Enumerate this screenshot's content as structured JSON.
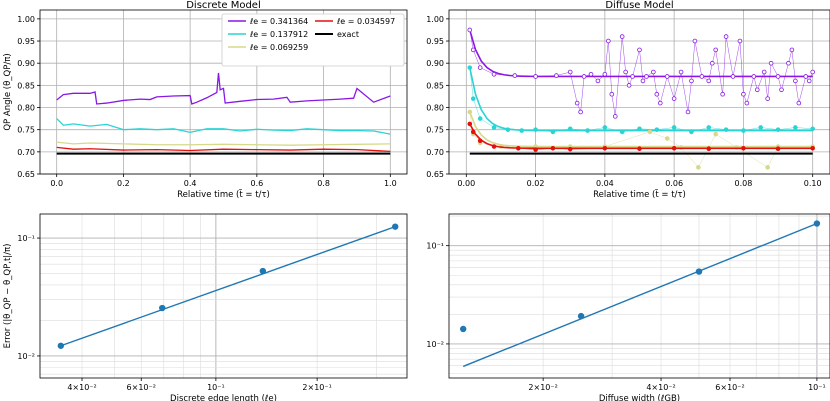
{
  "chart_data": [
    {
      "type": "line",
      "title": "Discrete Model",
      "xlabel": "Relative time (t̃ = t/τ)",
      "ylabel": "QP Angle (θ_QP/π)",
      "xlim": [
        -0.05,
        1.05
      ],
      "ylim": [
        0.65,
        1.02
      ],
      "xticks": [
        0.0,
        0.2,
        0.4,
        0.6,
        0.8,
        1.0
      ],
      "yticks": [
        0.65,
        0.7,
        0.75,
        0.8,
        0.85,
        0.9,
        0.95,
        1.0
      ],
      "grid": true,
      "legend_position": "top-right",
      "series": [
        {
          "name": "ℓe = 0.341364",
          "color": "#8a17e6",
          "x": [
            0.0,
            0.02,
            0.05,
            0.1,
            0.115,
            0.12,
            0.15,
            0.2,
            0.25,
            0.28,
            0.3,
            0.35,
            0.4,
            0.405,
            0.42,
            0.45,
            0.48,
            0.485,
            0.49,
            0.5,
            0.505,
            0.55,
            0.6,
            0.65,
            0.69,
            0.7,
            0.75,
            0.8,
            0.85,
            0.89,
            0.9,
            0.95,
            1.0
          ],
          "y": [
            0.817,
            0.829,
            0.832,
            0.832,
            0.835,
            0.808,
            0.81,
            0.816,
            0.819,
            0.818,
            0.824,
            0.826,
            0.827,
            0.808,
            0.812,
            0.822,
            0.834,
            0.878,
            0.84,
            0.843,
            0.81,
            0.814,
            0.818,
            0.819,
            0.823,
            0.812,
            0.815,
            0.817,
            0.819,
            0.821,
            0.843,
            0.812,
            0.826
          ]
        },
        {
          "name": "ℓe = 0.137912",
          "color": "#2bd4d4",
          "x": [
            0.0,
            0.02,
            0.05,
            0.1,
            0.15,
            0.2,
            0.25,
            0.3,
            0.35,
            0.4,
            0.45,
            0.5,
            0.55,
            0.6,
            0.65,
            0.7,
            0.75,
            0.8,
            0.85,
            0.9,
            0.95,
            1.0
          ],
          "y": [
            0.775,
            0.76,
            0.763,
            0.758,
            0.762,
            0.75,
            0.752,
            0.75,
            0.752,
            0.744,
            0.752,
            0.752,
            0.747,
            0.751,
            0.749,
            0.748,
            0.752,
            0.75,
            0.748,
            0.748,
            0.747,
            0.74
          ]
        },
        {
          "name": "ℓe = 0.069259",
          "color": "#d6d98a",
          "x": [
            0.0,
            0.05,
            0.1,
            0.2,
            0.3,
            0.4,
            0.5,
            0.6,
            0.7,
            0.8,
            0.9,
            1.0
          ],
          "y": [
            0.722,
            0.718,
            0.72,
            0.718,
            0.716,
            0.716,
            0.717,
            0.716,
            0.715,
            0.716,
            0.717,
            0.718
          ]
        },
        {
          "name": "ℓe = 0.034597",
          "color": "#e31010",
          "x": [
            0.0,
            0.05,
            0.1,
            0.2,
            0.3,
            0.4,
            0.5,
            0.6,
            0.7,
            0.8,
            0.9,
            1.0
          ],
          "y": [
            0.71,
            0.706,
            0.707,
            0.704,
            0.705,
            0.703,
            0.706,
            0.705,
            0.704,
            0.706,
            0.705,
            0.701
          ]
        },
        {
          "name": "exact",
          "color": "#000000",
          "x": [
            0.0,
            1.0
          ],
          "y": [
            0.696,
            0.696
          ]
        }
      ]
    },
    {
      "type": "line",
      "title": "Diffuse Model",
      "xlabel": "Relative time (t̃ = t/τ)",
      "ylabel": "",
      "xlim": [
        -0.005,
        0.105
      ],
      "ylim": [
        0.65,
        1.02
      ],
      "xticks": [
        0.0,
        0.02,
        0.04,
        0.06,
        0.08,
        0.1
      ],
      "xtick_labels": [
        "0.00",
        "0.02",
        "0.04",
        "0.06",
        "0.08",
        "0.10"
      ],
      "yticks": [
        0.65,
        0.7,
        0.75,
        0.8,
        0.85,
        0.9,
        0.95,
        1.0
      ],
      "grid": true,
      "series": [
        {
          "color": "#8a17e6",
          "fit_value": 0.87,
          "start": 0.975,
          "points": [
            [
              0.001,
              0.975
            ],
            [
              0.002,
              0.93
            ],
            [
              0.004,
              0.89
            ],
            [
              0.008,
              0.875
            ],
            [
              0.014,
              0.872
            ],
            [
              0.02,
              0.87
            ],
            [
              0.026,
              0.872
            ],
            [
              0.03,
              0.88
            ],
            [
              0.032,
              0.81
            ],
            [
              0.033,
              0.79
            ],
            [
              0.034,
              0.87
            ],
            [
              0.036,
              0.875
            ],
            [
              0.038,
              0.86
            ],
            [
              0.04,
              0.875
            ],
            [
              0.041,
              0.95
            ],
            [
              0.042,
              0.83
            ],
            [
              0.043,
              0.78
            ],
            [
              0.045,
              0.96
            ],
            [
              0.046,
              0.88
            ],
            [
              0.047,
              0.85
            ],
            [
              0.048,
              0.87
            ],
            [
              0.05,
              0.93
            ],
            [
              0.051,
              0.86
            ],
            [
              0.052,
              0.87
            ],
            [
              0.054,
              0.88
            ],
            [
              0.055,
              0.83
            ],
            [
              0.056,
              0.81
            ],
            [
              0.058,
              0.87
            ],
            [
              0.06,
              0.82
            ],
            [
              0.062,
              0.88
            ],
            [
              0.064,
              0.79
            ],
            [
              0.065,
              0.86
            ],
            [
              0.066,
              0.95
            ],
            [
              0.068,
              0.87
            ],
            [
              0.07,
              0.86
            ],
            [
              0.071,
              0.9
            ],
            [
              0.072,
              0.93
            ],
            [
              0.074,
              0.83
            ],
            [
              0.075,
              0.96
            ],
            [
              0.077,
              0.87
            ],
            [
              0.079,
              0.95
            ],
            [
              0.08,
              0.83
            ],
            [
              0.081,
              0.81
            ],
            [
              0.083,
              0.87
            ],
            [
              0.084,
              0.84
            ],
            [
              0.086,
              0.88
            ],
            [
              0.087,
              0.82
            ],
            [
              0.088,
              0.9
            ],
            [
              0.09,
              0.87
            ],
            [
              0.091,
              0.84
            ],
            [
              0.093,
              0.9
            ],
            [
              0.094,
              0.93
            ],
            [
              0.095,
              0.86
            ],
            [
              0.096,
              0.81
            ],
            [
              0.098,
              0.87
            ],
            [
              0.099,
              0.86
            ],
            [
              0.1,
              0.88
            ]
          ]
        },
        {
          "color": "#2bd4d4",
          "fit_value": 0.748,
          "start": 0.89,
          "points": [
            [
              0.001,
              0.89
            ],
            [
              0.002,
              0.82
            ],
            [
              0.004,
              0.775
            ],
            [
              0.008,
              0.755
            ],
            [
              0.012,
              0.75
            ],
            [
              0.016,
              0.748
            ],
            [
              0.02,
              0.75
            ],
            [
              0.025,
              0.745
            ],
            [
              0.03,
              0.752
            ],
            [
              0.035,
              0.748
            ],
            [
              0.04,
              0.755
            ],
            [
              0.045,
              0.745
            ],
            [
              0.05,
              0.752
            ],
            [
              0.055,
              0.75
            ],
            [
              0.06,
              0.755
            ],
            [
              0.065,
              0.745
            ],
            [
              0.07,
              0.755
            ],
            [
              0.075,
              0.75
            ],
            [
              0.08,
              0.748
            ],
            [
              0.085,
              0.755
            ],
            [
              0.09,
              0.75
            ],
            [
              0.095,
              0.755
            ],
            [
              0.1,
              0.752
            ]
          ]
        },
        {
          "color": "#d6d98a",
          "fit_value": 0.712,
          "start": 0.79,
          "points": [
            [
              0.001,
              0.79
            ],
            [
              0.002,
              0.74
            ],
            [
              0.004,
              0.72
            ],
            [
              0.01,
              0.712
            ],
            [
              0.02,
              0.712
            ],
            [
              0.03,
              0.712
            ],
            [
              0.04,
              0.712
            ],
            [
              0.053,
              0.745
            ],
            [
              0.058,
              0.73
            ],
            [
              0.062,
              0.71
            ],
            [
              0.067,
              0.665
            ],
            [
              0.072,
              0.74
            ],
            [
              0.078,
              0.71
            ],
            [
              0.087,
              0.665
            ],
            [
              0.09,
              0.712
            ],
            [
              0.1,
              0.712
            ]
          ]
        },
        {
          "color": "#e31010",
          "fit_value": 0.708,
          "start": 0.763,
          "points": [
            [
              0.001,
              0.763
            ],
            [
              0.002,
              0.745
            ],
            [
              0.004,
              0.725
            ],
            [
              0.008,
              0.712
            ],
            [
              0.015,
              0.708
            ],
            [
              0.02,
              0.705
            ],
            [
              0.025,
              0.708
            ],
            [
              0.03,
              0.706
            ],
            [
              0.04,
              0.708
            ],
            [
              0.05,
              0.707
            ],
            [
              0.06,
              0.708
            ],
            [
              0.07,
              0.707
            ],
            [
              0.08,
              0.708
            ],
            [
              0.09,
              0.707
            ],
            [
              0.1,
              0.708
            ]
          ]
        },
        {
          "color": "#000000",
          "fit_value": 0.696,
          "start": 0.696,
          "points": []
        }
      ]
    },
    {
      "type": "scatter",
      "xscale": "log",
      "yscale": "log",
      "xlabel": "Discrete edge length (ℓe)",
      "ylabel": "Error (|θ_QP − θ_QP,t|/π)",
      "xlim": [
        0.03,
        0.37
      ],
      "ylim": [
        0.0065,
        0.16
      ],
      "xticks": [
        0.04,
        0.06,
        0.1,
        0.2
      ],
      "xtick_labels": [
        "4×10⁻²",
        "6×10⁻²",
        "10⁻¹",
        "2×10⁻¹"
      ],
      "yticks": [
        0.01,
        0.1
      ],
      "ytick_labels": [
        "10⁻²",
        "10⁻¹"
      ],
      "color": "#1f77b4",
      "points": [
        [
          0.034597,
          0.0122
        ],
        [
          0.069259,
          0.0255
        ],
        [
          0.137912,
          0.0525
        ],
        [
          0.341364,
          0.125
        ]
      ],
      "fit_line": [
        [
          0.034597,
          0.0122
        ],
        [
          0.341364,
          0.125
        ]
      ]
    },
    {
      "type": "scatter",
      "xscale": "log",
      "yscale": "log",
      "xlabel": "Diffuse width (ℓGB)",
      "ylabel": "",
      "xlim": [
        0.0115,
        0.108
      ],
      "ylim": [
        0.0045,
        0.21
      ],
      "xticks": [
        0.02,
        0.04,
        0.06,
        0.1
      ],
      "xtick_labels": [
        "2×10⁻²",
        "4×10⁻²",
        "6×10⁻²",
        "10⁻¹"
      ],
      "yticks": [
        0.01,
        0.1
      ],
      "ytick_labels": [
        "10⁻²",
        "10⁻¹"
      ],
      "color": "#1f77b4",
      "points": [
        [
          0.0125,
          0.0142
        ],
        [
          0.025,
          0.0192
        ],
        [
          0.05,
          0.0545
        ],
        [
          0.1,
          0.168
        ]
      ],
      "fit_line": [
        [
          0.0125,
          0.0059
        ],
        [
          0.1,
          0.168
        ]
      ]
    }
  ]
}
